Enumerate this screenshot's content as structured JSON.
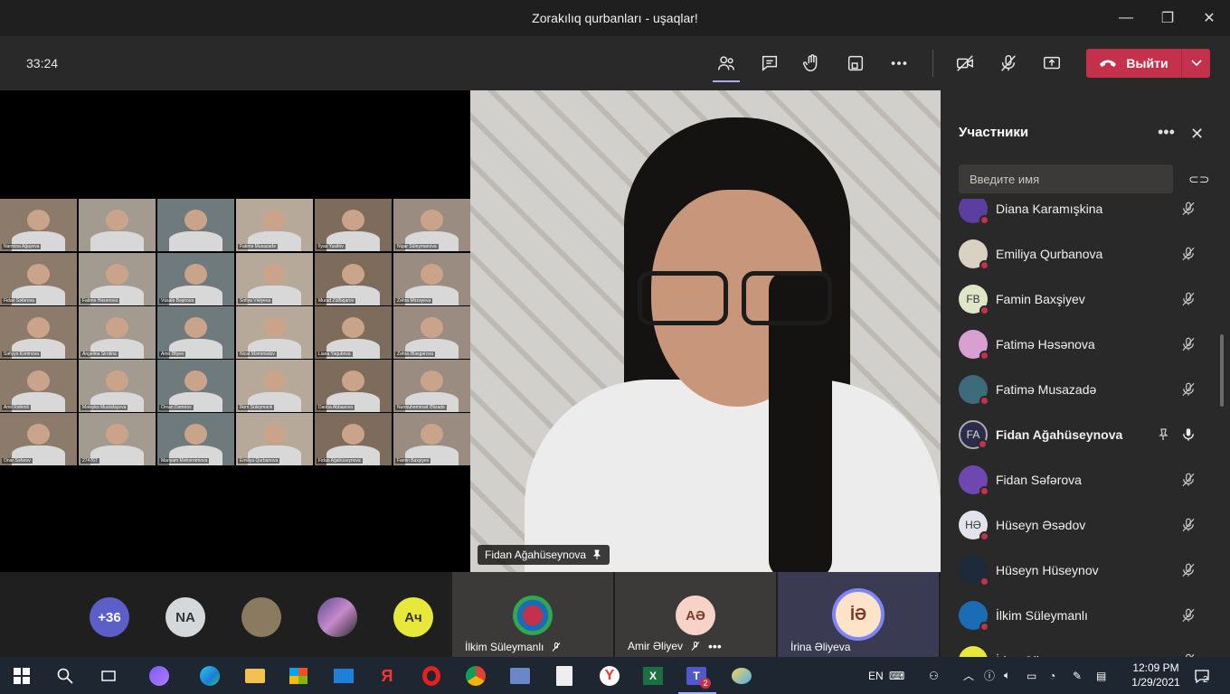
{
  "window": {
    "title": "Zorakılıq qurbanları - uşaqlar!",
    "minimize": "—",
    "maximize": "❐",
    "close": "✕"
  },
  "toolbar": {
    "timer": "33:24",
    "leave_label": "Выйти"
  },
  "colors": {
    "accent": "#a9abf0",
    "leave": "#c4314b",
    "busy_dot": "#c4314b"
  },
  "grid_tiles": [
    "Narmina Ağayeva",
    "",
    "",
    "Fatimə Musazadə",
    "İlyas Yusifov",
    "Nigar Süleymanova",
    "Fidan Səfərova",
    "Fatimə Həsənova",
    "Vüsalə Bəşirova",
    "Sofiya Vəliyeva",
    "Murad Zülfüqarov",
    "Zəhra Mirzəyeva",
    "Səfiyyə Kərimova",
    "Angelina Sirotina",
    "Amir Əliyev",
    "Nicat Məmmədov",
    "Liana Yaqubova",
    "Zəhra Ələsgərova",
    "Amil Rəhimli",
    "Mələykə Mustafayeva",
    "Orxan Dəmirov",
    "İlkim Süleymanlı",
    "Darina Abbasova",
    "Nurmuhəmməd Əlizadə",
    "Onar Səfərov",
    "274767",
    "Mariyam Məhərrəmova",
    "Emiliya Qurbanova",
    "Fidan Ağahüseynova",
    "Famin Baxşiyev"
  ],
  "pinned_video": {
    "name": "Fidan Ağahüseynova"
  },
  "strip": {
    "overflow": "+36",
    "avatars": [
      {
        "initials": "NA",
        "color": "#d5d8da"
      },
      {
        "initials": "",
        "color": "#8a7a60"
      },
      {
        "initials": "",
        "color": "#5a4c8c"
      },
      {
        "initials": "Ач",
        "color": "#e8e83a"
      }
    ],
    "tiles": [
      {
        "name": "İlkim Süleymanlı",
        "initials": ""
      },
      {
        "name": "Amir Əliyev",
        "initials": "AƏ"
      },
      {
        "name": "İrina Əliyeva",
        "initials": "İƏ"
      }
    ]
  },
  "panel": {
    "title": "Участники",
    "search_placeholder": "Введите имя",
    "participants": [
      {
        "name": "Diana Karamışkina",
        "initials": "",
        "color": "#5b3fa0"
      },
      {
        "name": "Emiliya Qurbanova",
        "initials": "",
        "color": "#d9d2c3"
      },
      {
        "name": "Famin Baxşiyev",
        "initials": "FB",
        "color": "#dfe6c8"
      },
      {
        "name": "Fatimə Həsənova",
        "initials": "",
        "color": "#d7a0d0"
      },
      {
        "name": "Fatimə Musazadə",
        "initials": "",
        "color": "#3d6b7a"
      },
      {
        "name": "Fidan Ağahüseynova",
        "initials": "FA",
        "color": "#2c2c4a"
      },
      {
        "name": "Fidan Səfərova",
        "initials": "",
        "color": "#6e48b0"
      },
      {
        "name": "Hüseyn Əsədov",
        "initials": "HƏ",
        "color": "#e3e3ec"
      },
      {
        "name": "Hüseyn Hüseynov",
        "initials": "",
        "color": "#1e2a3a"
      },
      {
        "name": "İlkim Süleymanlı",
        "initials": "",
        "color": "#1b6bb5"
      },
      {
        "name": "İrina Əliyeva",
        "initials": "",
        "color": "#e8e83a"
      }
    ]
  },
  "taskbar": {
    "lang": "EN",
    "time": "12:09 PM",
    "date": "1/29/2021",
    "notifications": "2",
    "teams_badge": "2"
  }
}
